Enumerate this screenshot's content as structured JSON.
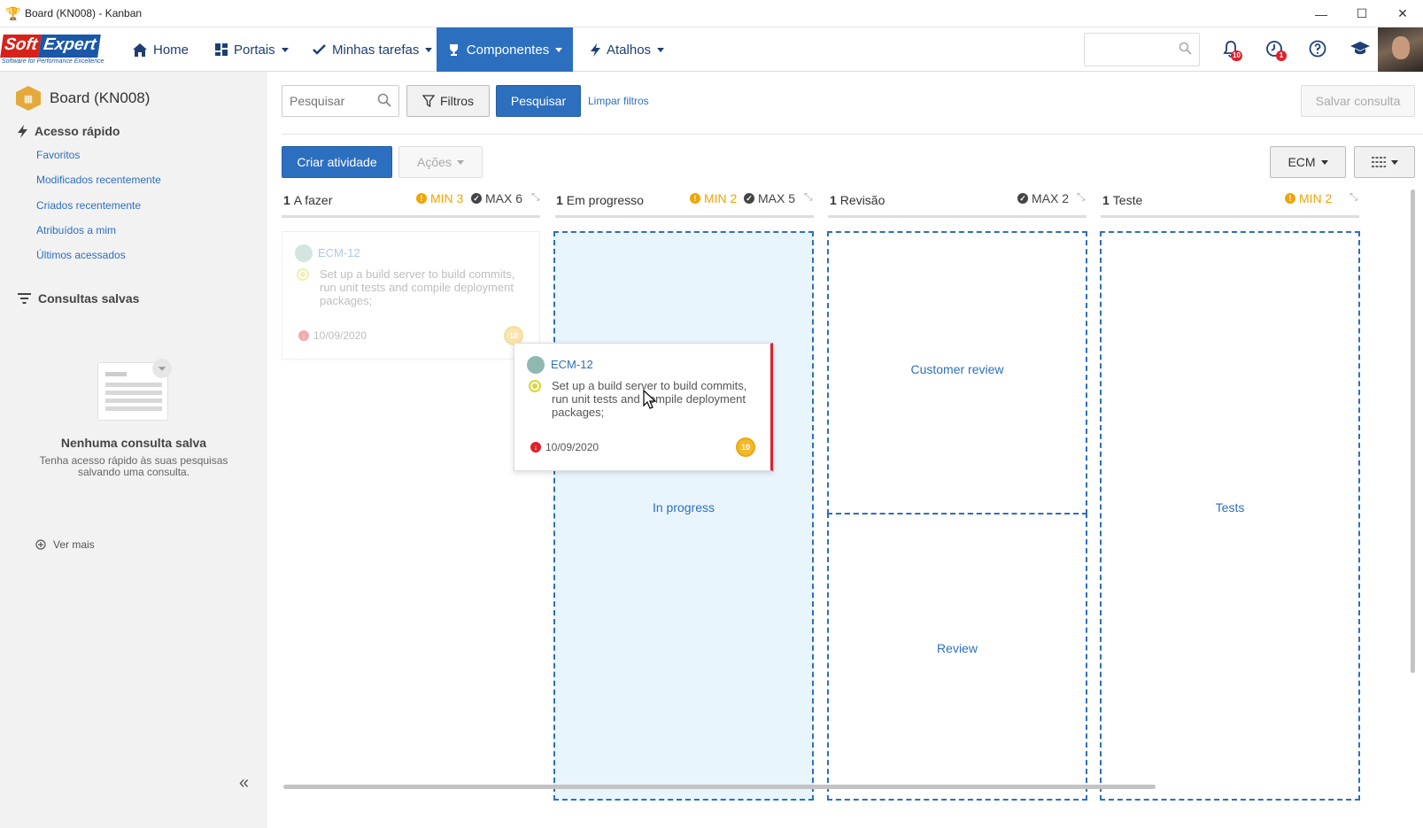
{
  "window": {
    "title": "Board (KN008) - Kanban",
    "controls": {
      "minimize": "—",
      "maximize": "☐",
      "close": "✕"
    }
  },
  "brand": {
    "soft": "Soft",
    "expert": "Expert",
    "tagline": "Software for Performance Excellence"
  },
  "nav": {
    "home": "Home",
    "portais": "Portais",
    "tarefas": "Minhas tarefas",
    "componentes": "Componentes",
    "atalhos": "Atalhos",
    "notifications_count": "10",
    "alerts_count": "1"
  },
  "sidebar": {
    "title": "Board (KN008)",
    "quick_access_title": "Acesso rápido",
    "quick_links": [
      "Favoritos",
      "Modificados recentemente",
      "Criados recentemente",
      "Atribuídos a mim",
      "Últimos acessados"
    ],
    "saved_title": "Consultas salvas",
    "empty_title": "Nenhuma consulta salva",
    "empty_sub": "Tenha acesso rápido às suas pesquisas salvando uma consulta.",
    "ver_mais": "Ver mais"
  },
  "toolbar": {
    "search_placeholder": "Pesquisar",
    "filters_label": "Filtros",
    "search_label": "Pesquisar",
    "clear_label": "Limpar filtros",
    "save_query_label": "Salvar consulta",
    "create_label": "Criar atividade",
    "actions_label": "Ações",
    "ecm_label": "ECM"
  },
  "columns": [
    {
      "count": "1",
      "name": "A fazer",
      "min": "MIN 3",
      "max": "MAX 6"
    },
    {
      "count": "1",
      "name": "Em progresso",
      "min": "MIN 2",
      "max": "MAX 5"
    },
    {
      "count": "1",
      "name": "Revisão",
      "min": "",
      "max": "MAX 2"
    },
    {
      "count": "1",
      "name": "Teste",
      "min": "MIN 2",
      "max": ""
    }
  ],
  "card": {
    "id": "ECM-12",
    "description": "Set up a build server to build commits, run unit tests and compile deployment packages;",
    "due_date": "10/09/2020",
    "points": "10"
  },
  "drop_zones": {
    "in_progress": "In progress",
    "customer_review": "Customer review",
    "review": "Review",
    "tests": "Tests"
  },
  "colors": {
    "primary": "#2d6fbf",
    "warning": "#f0a500",
    "danger": "#e0202a"
  }
}
